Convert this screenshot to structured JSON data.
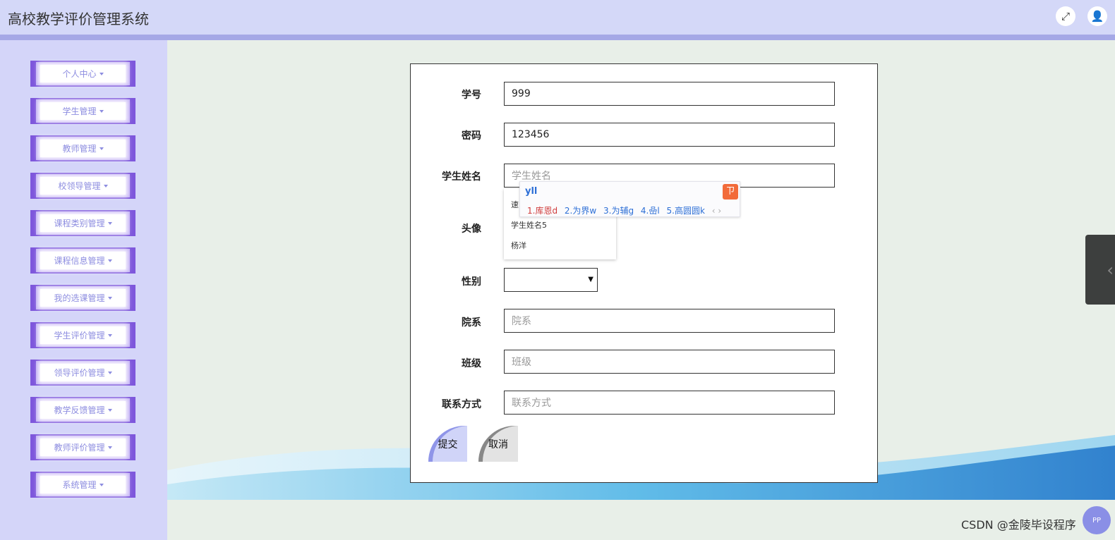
{
  "app": {
    "title": "高校教学评价管理系统"
  },
  "header_icons": [
    {
      "name": "fullscreen-icon",
      "glyph": "⤢"
    },
    {
      "name": "user-icon",
      "glyph": "👤"
    }
  ],
  "sidebar": {
    "items": [
      {
        "label": "个人中心"
      },
      {
        "label": "学生管理"
      },
      {
        "label": "教师管理"
      },
      {
        "label": "校领导管理"
      },
      {
        "label": "课程类别管理"
      },
      {
        "label": "课程信息管理"
      },
      {
        "label": "我的选课管理"
      },
      {
        "label": "学生评价管理"
      },
      {
        "label": "领导评价管理"
      },
      {
        "label": "教学反馈管理"
      },
      {
        "label": "教师评价管理"
      },
      {
        "label": "系统管理"
      }
    ]
  },
  "form": {
    "fields": {
      "student_id": {
        "label": "学号",
        "value": "999"
      },
      "password": {
        "label": "密码",
        "value": "123456"
      },
      "student_name": {
        "label": "学生姓名",
        "value": "",
        "placeholder": "学生姓名"
      },
      "avatar": {
        "label": "头像"
      },
      "gender": {
        "label": "性别",
        "value": ""
      },
      "department": {
        "label": "院系",
        "value": "",
        "placeholder": "院系"
      },
      "class": {
        "label": "班级",
        "value": "",
        "placeholder": "班级"
      },
      "contact": {
        "label": "联系方式",
        "value": "",
        "placeholder": "联系方式"
      }
    },
    "autocomplete": [
      "速",
      "学生姓名5",
      "杨洋"
    ],
    "submit_label": "提交",
    "cancel_label": "取消"
  },
  "ime": {
    "input": "yll",
    "candidates": [
      "1.库恩d",
      "2.为界w",
      "3.为辅g",
      "4.喦l",
      "5.高圆圆k"
    ],
    "nav": "‹ ›"
  },
  "watermark": "CSDN @金陵毕设程序",
  "corner_badge": "PP",
  "colors": {
    "header_bg": "#d4d8f8",
    "sidebar_bg": "#d4d5f9",
    "menu_accent": "#7e57dc",
    "content_bg": "#e8efe8"
  }
}
